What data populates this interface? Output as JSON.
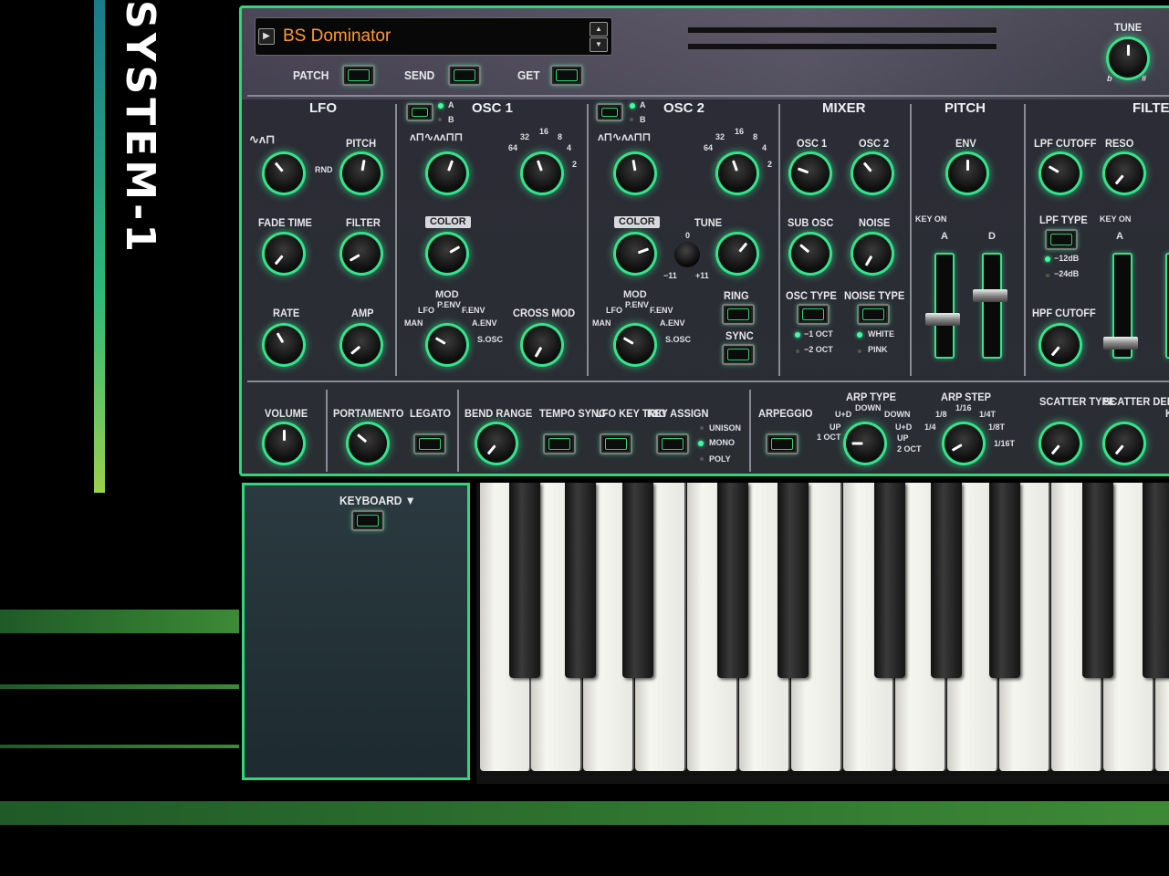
{
  "logo": {
    "text": "SYSTEM-1"
  },
  "patch": {
    "name": "BS Dominator",
    "patch_label": "PATCH",
    "send_label": "SEND",
    "get_label": "GET"
  },
  "tune": {
    "label": "TUNE",
    "flat": "b",
    "sharp": "#"
  },
  "lfo": {
    "title": "LFO",
    "pitch": "PITCH",
    "rnd": "RND",
    "fade_time": "FADE TIME",
    "filter": "FILTER",
    "rate": "RATE",
    "amp": "AMP",
    "minus": "−",
    "plus": "+"
  },
  "osc1": {
    "title": "OSC 1",
    "a": "A",
    "b": "B",
    "color": "COLOR",
    "mod": "MOD",
    "lfo": "LFO",
    "penv": "P.ENV",
    "fenv": "F.ENV",
    "man": "MAN",
    "aenv": "A.ENV",
    "sosc": "S.OSC",
    "cross_mod": "CROSS MOD",
    "r32": "32",
    "r16": "16",
    "r8": "8",
    "r64": "64",
    "r4": "4",
    "r2": "2"
  },
  "osc2": {
    "title": "OSC 2",
    "a": "A",
    "b": "B",
    "color": "COLOR",
    "tune": "TUNE",
    "zero": "0",
    "m11": "−11",
    "p11": "+11",
    "mod": "MOD",
    "lfo": "LFO",
    "penv": "P.ENV",
    "fenv": "F.ENV",
    "man": "MAN",
    "aenv": "A.ENV",
    "sosc": "S.OSC",
    "ring": "RING",
    "sync": "SYNC",
    "r32": "32",
    "r16": "16",
    "r8": "8",
    "r64": "64",
    "r4": "4",
    "r2": "2"
  },
  "mixer": {
    "title": "MIXER",
    "osc1": "OSC 1",
    "osc2": "OSC 2",
    "sub_osc": "SUB OSC",
    "noise": "NOISE",
    "osc_type": "OSC TYPE",
    "noise_type": "NOISE TYPE",
    "m1oct": "−1 OCT",
    "m2oct": "−2 OCT",
    "white": "WHITE",
    "pink": "PINK"
  },
  "pitch": {
    "title": "PITCH",
    "env": "ENV",
    "key_on": "KEY ON",
    "a": "A",
    "d": "D"
  },
  "filter": {
    "title": "FILTE",
    "lpf_cutoff": "LPF CUTOFF",
    "reso": "RESO",
    "lpf_type": "LPF TYPE",
    "key_on": "KEY ON",
    "a": "A",
    "db12": "−12dB",
    "db24": "−24dB",
    "hpf_cutoff": "HPF CUTOFF"
  },
  "bottom": {
    "volume": "VOLUME",
    "portamento": "PORTAMENTO",
    "legato": "LEGATO",
    "bend_range": "BEND RANGE",
    "tempo_sync": "TEMPO SYNC",
    "lfo_key_trig": "LFO KEY TRIG",
    "key_assign": "KEY ASSIGN",
    "unison": "UNISON",
    "mono": "MONO",
    "poly": "POLY",
    "arpeggio": "ARPEGGIO",
    "arp_type": "ARP TYPE",
    "down1": "DOWN",
    "ud": "U+D",
    "down2": "DOWN",
    "up1": "UP",
    "ud2": "U+D",
    "oct1": "1 OCT",
    "up2": "UP",
    "oct2": "2 OCT",
    "arp_step": "ARP STEP",
    "s116": "1/16",
    "s18": "1/8",
    "s14t": "1/4T",
    "s14": "1/4",
    "s18t": "1/8T",
    "s116t": "1/16T",
    "scatter_type": "SCATTER TYPE",
    "scatter_depth": "SCATTER DEPTH",
    "ke": "KE"
  },
  "keyboard": {
    "label": "KEYBOARD ▼"
  }
}
